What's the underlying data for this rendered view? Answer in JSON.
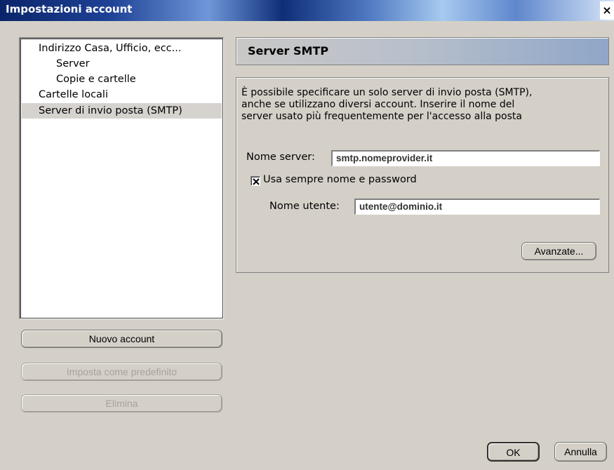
{
  "window": {
    "title": "Impostazioni account",
    "close_glyph": "×"
  },
  "tree": {
    "items": [
      {
        "label": "Indirizzo Casa, Ufficio, ecc...",
        "level": 0,
        "selected": false
      },
      {
        "label": "Server",
        "level": 1,
        "selected": false
      },
      {
        "label": "Copie e cartelle",
        "level": 1,
        "selected": false
      },
      {
        "label": "Cartelle locali",
        "level": 0,
        "selected": false
      },
      {
        "label": "Server di invio posta (SMTP)",
        "level": 0,
        "selected": true
      }
    ]
  },
  "left_buttons": {
    "new_account": "Nuovo account",
    "set_default": "Imposta come predefinito",
    "delete": "Elimina"
  },
  "panel": {
    "title": "Server SMTP",
    "description_lines": [
      "È possibile specificare un solo server di invio posta (SMTP),",
      "anche se utilizzano diversi account. Inserire il nome del",
      "server usato più frequentemente per l'accesso alla posta"
    ],
    "server_label": "Nome server:",
    "server_value": "smtp.nomeprovider.it",
    "always_auth_label": "Usa sempre nome e password",
    "always_auth_checked": true,
    "username_label": "Nome utente:",
    "username_value": "utente@dominio.it",
    "advanced_button": "Avanzate..."
  },
  "footer": {
    "ok": "OK",
    "cancel": "Annulla"
  }
}
